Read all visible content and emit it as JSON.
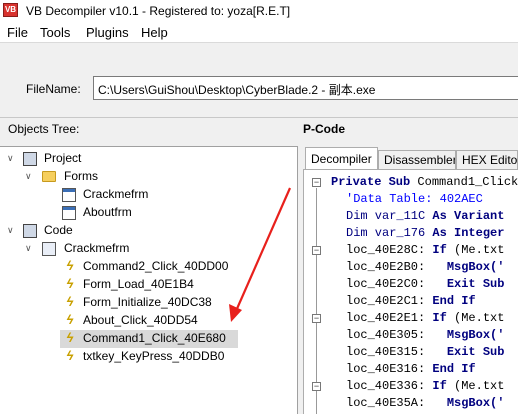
{
  "window": {
    "title": "VB Decompiler v10.1 - Registered to: yoza[R.E.T]"
  },
  "menu": {
    "items": [
      "File",
      "Tools",
      "Plugins",
      "Help"
    ]
  },
  "filename": {
    "label": "FileName:",
    "value": "C:\\Users\\GuiShou\\Desktop\\CyberBlade.2 - 副本.exe"
  },
  "panes": {
    "objects_tree": "Objects Tree:",
    "pcode": "P-Code"
  },
  "tree": {
    "project": "Project",
    "forms": "Forms",
    "form_items": [
      "Crackmefrm",
      "Aboutfrm"
    ],
    "code": "Code",
    "code_module": "Crackmefrm",
    "functions": [
      "Command2_Click_40DD00",
      "Form_Load_40E1B4",
      "Form_Initialize_40DC38",
      "About_Click_40DD54",
      "Command1_Click_40E680",
      "txtkey_KeyPress_40DDB0"
    ],
    "selected_index": 4
  },
  "tabs": [
    "Decompiler",
    "Disassembler",
    "HEX Editor"
  ],
  "code": {
    "header_kw": "Private Sub",
    "header_rest": " Command1_Click",
    "data_table": "'Data Table: 402AEC",
    "dim1_a": "Dim var_11C ",
    "dim1_b": "As Variant",
    "dim2_a": "Dim var_176 ",
    "dim2_b": "As Integer",
    "l1_a": "loc_40E28C: ",
    "l1_b": "If",
    "l1_c": " (Me.txt",
    "l2_a": "loc_40E2B0:   ",
    "l2_b": "MsgBox('",
    "l3_a": "loc_40E2C0:   ",
    "l3_b": "Exit Sub",
    "l4_a": "loc_40E2C1: ",
    "l4_b": "End If",
    "l5_a": "loc_40E2E1: ",
    "l5_b": "If",
    "l5_c": " (Me.txt",
    "l6_a": "loc_40E305:   ",
    "l6_b": "MsgBox('",
    "l7_a": "loc_40E315:   ",
    "l7_b": "Exit Sub",
    "l8_a": "loc_40E316: ",
    "l8_b": "End If",
    "l9_a": "loc_40E336: ",
    "l9_b": "If",
    "l9_c": " (Me.txt",
    "l10_a": "loc_40E35A:   ",
    "l10_b": "MsgBox('"
  },
  "colors": {
    "keyword": "#00007f",
    "comment_string": "#0000ff",
    "annotation_arrow": "#e8201c",
    "selection": "#d9d9d9"
  }
}
